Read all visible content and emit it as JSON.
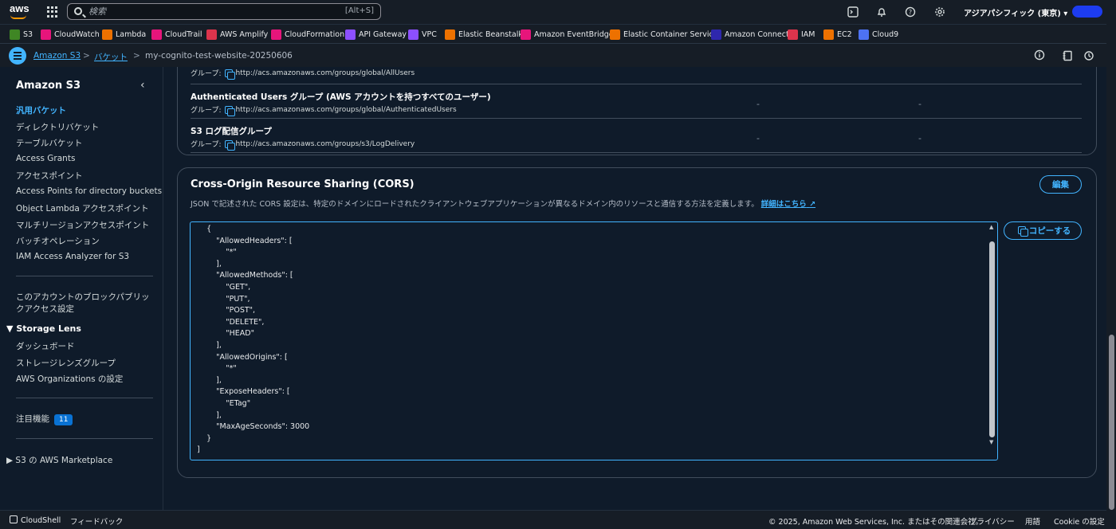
{
  "topnav": {
    "logo": "aws",
    "search_placeholder": "検索",
    "search_shortcut": "[Alt+S]",
    "region": "アジアパシフィック (東京) ▾"
  },
  "services": [
    {
      "label": "S3",
      "color": "#3f8624"
    },
    {
      "label": "CloudWatch",
      "color": "#e7157b"
    },
    {
      "label": "Lambda",
      "color": "#ed7100"
    },
    {
      "label": "CloudTrail",
      "color": "#e7157b"
    },
    {
      "label": "AWS Amplify",
      "color": "#dd344c"
    },
    {
      "label": "CloudFormation",
      "color": "#e7157b"
    },
    {
      "label": "API Gateway",
      "color": "#8c4fff"
    },
    {
      "label": "VPC",
      "color": "#8c4fff"
    },
    {
      "label": "Elastic Beanstalk",
      "color": "#ed7100"
    },
    {
      "label": "Amazon EventBridge",
      "color": "#e7157b"
    },
    {
      "label": "Elastic Container Service",
      "color": "#ed7100"
    },
    {
      "label": "Amazon Connect",
      "color": "#2e27ad"
    },
    {
      "label": "IAM",
      "color": "#dd344c"
    },
    {
      "label": "EC2",
      "color": "#ed7100"
    },
    {
      "label": "Cloud9",
      "color": "#4d72f3"
    }
  ],
  "breadcrumb": {
    "root": "Amazon S3",
    "buckets": "バケット",
    "current": "my-cognito-test-website-20250606"
  },
  "sidebar": {
    "title": "Amazon S3",
    "items": [
      "汎用バケット",
      "ディレクトリバケット",
      "テーブルバケット",
      "Access Grants",
      "アクセスポイント",
      "Access Points for directory buckets",
      "Object Lambda アクセスポイント",
      "マルチリージョンアクセスポイント",
      "バッチオペレーション",
      "IAM Access Analyzer for S3"
    ],
    "block_access_line1": "このアカウントのブロックパブリッ",
    "block_access_line2": "クアクセス設定",
    "storage_lens": "Storage Lens",
    "storage_items": [
      "ダッシュボード",
      "ストレージレンズグループ",
      "AWS Organizations の設定"
    ],
    "featured": "注目機能",
    "featured_count": "11",
    "marketplace": "S3 の AWS Marketplace"
  },
  "acl": {
    "group_label": "グループ:",
    "rows": [
      {
        "name": "",
        "uri": "http://acs.amazonaws.com/groups/global/AllUsers"
      },
      {
        "name": "Authenticated Users グループ (AWS アカウントを持つすべてのユーザー)",
        "uri": "http://acs.amazonaws.com/groups/global/AuthenticatedUsers",
        "col1": "-",
        "col2": "-"
      },
      {
        "name": "S3 ログ配信グループ",
        "uri": "http://acs.amazonaws.com/groups/s3/LogDelivery",
        "col1": "-",
        "col2": "-"
      }
    ]
  },
  "cors": {
    "title": "Cross-Origin Resource Sharing (CORS)",
    "description": "JSON で記述された CORS 設定は、特定のドメインにロードされたクライアントウェブアプリケーションが異なるドメイン内のリソースと通信する方法を定義します。",
    "learn_more": "詳細はこちら",
    "edit_label": "編集",
    "copy_label": "コピーする",
    "json": "    {\n        \"AllowedHeaders\": [\n            \"*\"\n        ],\n        \"AllowedMethods\": [\n            \"GET\",\n            \"PUT\",\n            \"POST\",\n            \"DELETE\",\n            \"HEAD\"\n        ],\n        \"AllowedOrigins\": [\n            \"*\"\n        ],\n        \"ExposeHeaders\": [\n            \"ETag\"\n        ],\n        \"MaxAgeSeconds\": 3000\n    }\n]"
  },
  "footer": {
    "cloudshell": "CloudShell",
    "feedback": "フィードバック",
    "copyright": "© 2025, Amazon Web Services, Inc. またはその関連会社。",
    "privacy": "プライバシー",
    "terms": "用語",
    "cookies": "Cookie の設定"
  }
}
